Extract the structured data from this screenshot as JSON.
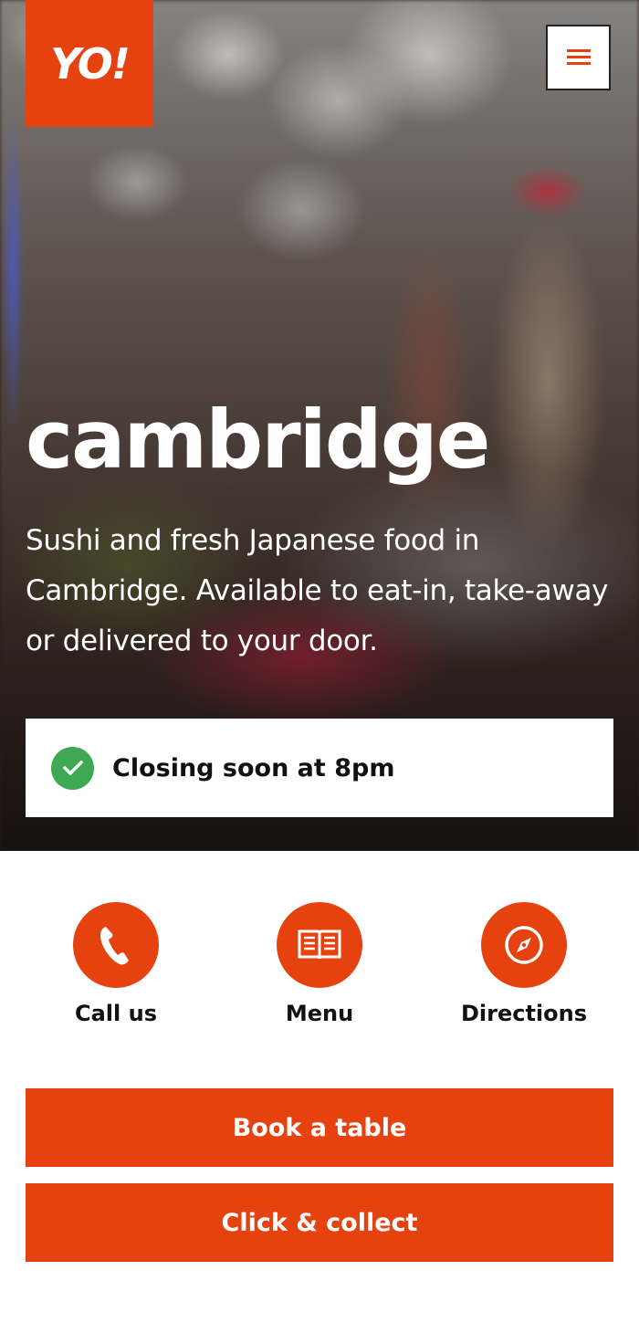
{
  "brand": {
    "logo_text": "YO!",
    "accent_color": "#e5420f",
    "success_color": "#3ea852"
  },
  "header": {
    "menu_icon": "hamburger-icon"
  },
  "hero": {
    "title": "cambridge",
    "description": "Sushi and fresh Japanese food in Cambridge. Available to eat-in, take-away or delivered to your door.",
    "status": {
      "icon": "check-icon",
      "text": "Closing soon at 8pm"
    }
  },
  "actions": [
    {
      "icon": "phone-icon",
      "label": "Call us"
    },
    {
      "icon": "book-icon",
      "label": "Menu"
    },
    {
      "icon": "compass-icon",
      "label": "Directions"
    }
  ],
  "cta": {
    "book_label": "Book a table",
    "collect_label": "Click & collect"
  }
}
